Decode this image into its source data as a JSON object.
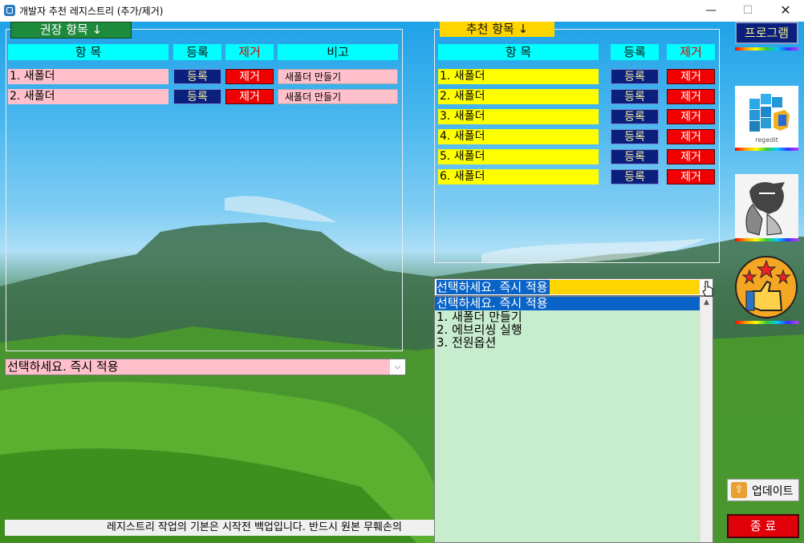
{
  "window": {
    "title": "개발자 추천 레지스트리 (추가/제거)",
    "min_glyph": "—",
    "max_glyph": "☐",
    "close_glyph": "✕"
  },
  "left": {
    "header": "권장  항목  ↓",
    "col_item": "항 목",
    "col_reg": "등록",
    "col_del": "제거",
    "col_note": "비고",
    "rows": [
      {
        "item": "1. 새폴더",
        "reg": "등록",
        "del": "제거",
        "note": "새폴더 만들기"
      },
      {
        "item": "2. 새폴더",
        "reg": "등록",
        "del": "제거",
        "note": "새폴더 만들기"
      }
    ],
    "select_value": "선택하세요. 즉시 적용"
  },
  "right": {
    "header": "추천 항목  ↓",
    "col_item": "항 목",
    "col_reg": "등록",
    "col_del": "제거",
    "rows": [
      {
        "item": "1. 새폴더",
        "reg": "등록",
        "del": "제거"
      },
      {
        "item": "2. 새폴더",
        "reg": "등록",
        "del": "제거"
      },
      {
        "item": "3. 새폴더",
        "reg": "등록",
        "del": "제거"
      },
      {
        "item": "4. 새폴더",
        "reg": "등록",
        "del": "제거"
      },
      {
        "item": "5. 새폴더",
        "reg": "등록",
        "del": "제거"
      },
      {
        "item": "6. 새폴더",
        "reg": "등록",
        "del": "제거"
      }
    ],
    "combo_value": "선택하세요. 즉시 적용",
    "options": [
      "선택하세요. 즉시 적용",
      "1. 새폴더 만들기",
      "2. 에브리씽 실행",
      "3. 전원옵션"
    ]
  },
  "sidebar": {
    "program_label": "프로그램",
    "regedit_label": "regedit",
    "update_label": "업데이트",
    "exit_label": "종  료"
  },
  "status": {
    "message": "레지스트리 작업의 기본은 시작전 백업입니다. 반드시 원본 무훼손의"
  },
  "colors": {
    "left_header": "#1e8a3c",
    "right_header": "#ffd500",
    "cyan": "#00ffff",
    "pink": "#ffc0cb",
    "yellow": "#ffff00",
    "navy": "#0b1f7d",
    "red": "#f00000",
    "list_bg": "#c8ecce",
    "list_select": "#0a64c8"
  }
}
